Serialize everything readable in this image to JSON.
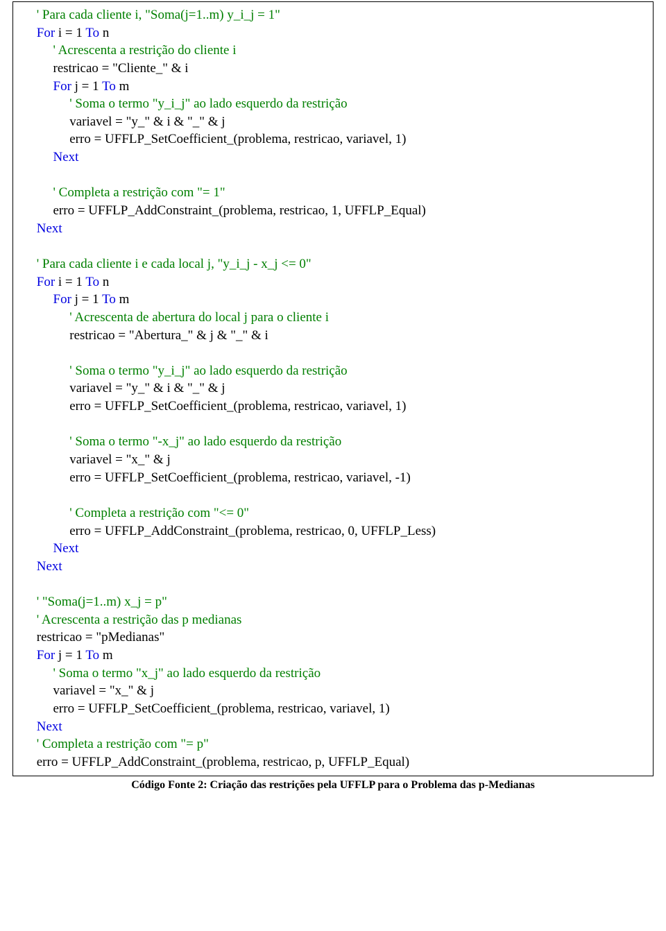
{
  "code": [
    {
      "indent": 1,
      "spans": [
        [
          "comment",
          "' Para cada cliente i, \"Soma(j=1..m) y_i_j = 1\""
        ]
      ]
    },
    {
      "indent": 1,
      "spans": [
        [
          "kw",
          "For"
        ],
        [
          "plain",
          " i = 1 "
        ],
        [
          "kw",
          "To"
        ],
        [
          "plain",
          " n"
        ]
      ]
    },
    {
      "indent": 2,
      "spans": [
        [
          "comment",
          "' Acrescenta a restrição do cliente i"
        ]
      ]
    },
    {
      "indent": 2,
      "spans": [
        [
          "plain",
          "restricao = \"Cliente_\" & i"
        ]
      ]
    },
    {
      "indent": 2,
      "spans": [
        [
          "kw",
          "For"
        ],
        [
          "plain",
          " j = 1 "
        ],
        [
          "kw",
          "To"
        ],
        [
          "plain",
          " m"
        ]
      ]
    },
    {
      "indent": 3,
      "spans": [
        [
          "comment",
          "' Soma o termo \"y_i_j\" ao lado esquerdo da restrição"
        ]
      ]
    },
    {
      "indent": 3,
      "spans": [
        [
          "plain",
          "variavel = \"y_\" & i & \"_\" & j"
        ]
      ]
    },
    {
      "indent": 3,
      "spans": [
        [
          "plain",
          "erro = UFFLP_SetCoefficient_(problema, restricao, variavel, 1)"
        ]
      ]
    },
    {
      "indent": 2,
      "spans": [
        [
          "kw",
          "Next"
        ]
      ]
    },
    {
      "blank": true
    },
    {
      "indent": 2,
      "spans": [
        [
          "comment",
          "' Completa a restrição com \"= 1\""
        ]
      ]
    },
    {
      "indent": 2,
      "spans": [
        [
          "plain",
          "erro = UFFLP_AddConstraint_(problema, restricao, 1, UFFLP_Equal)"
        ]
      ]
    },
    {
      "indent": 1,
      "spans": [
        [
          "kw",
          "Next"
        ]
      ]
    },
    {
      "blank": true
    },
    {
      "indent": 1,
      "spans": [
        [
          "comment",
          "' Para cada cliente i e cada local j, \"y_i_j - x_j <= 0\""
        ]
      ]
    },
    {
      "indent": 1,
      "spans": [
        [
          "kw",
          "For"
        ],
        [
          "plain",
          " i = 1 "
        ],
        [
          "kw",
          "To"
        ],
        [
          "plain",
          " n"
        ]
      ]
    },
    {
      "indent": 2,
      "spans": [
        [
          "kw",
          "For"
        ],
        [
          "plain",
          " j = 1 "
        ],
        [
          "kw",
          "To"
        ],
        [
          "plain",
          " m"
        ]
      ]
    },
    {
      "indent": 3,
      "spans": [
        [
          "comment",
          "' Acrescenta de abertura do local j para o cliente i"
        ]
      ]
    },
    {
      "indent": 3,
      "spans": [
        [
          "plain",
          "restricao = \"Abertura_\" & j & \"_\" & i"
        ]
      ]
    },
    {
      "blank": true
    },
    {
      "indent": 3,
      "spans": [
        [
          "comment",
          "' Soma o termo \"y_i_j\" ao lado esquerdo da restrição"
        ]
      ]
    },
    {
      "indent": 3,
      "spans": [
        [
          "plain",
          "variavel = \"y_\" & i & \"_\" & j"
        ]
      ]
    },
    {
      "indent": 3,
      "spans": [
        [
          "plain",
          "erro = UFFLP_SetCoefficient_(problema, restricao, variavel, 1)"
        ]
      ]
    },
    {
      "blank": true
    },
    {
      "indent": 3,
      "spans": [
        [
          "comment",
          "' Soma o termo \"-x_j\" ao lado esquerdo da restrição"
        ]
      ]
    },
    {
      "indent": 3,
      "spans": [
        [
          "plain",
          "variavel = \"x_\" & j"
        ]
      ]
    },
    {
      "indent": 3,
      "spans": [
        [
          "plain",
          "erro = UFFLP_SetCoefficient_(problema, restricao, variavel, -1)"
        ]
      ]
    },
    {
      "blank": true
    },
    {
      "indent": 3,
      "spans": [
        [
          "comment",
          "' Completa a restrição com \"<= 0\""
        ]
      ]
    },
    {
      "indent": 3,
      "spans": [
        [
          "plain",
          "erro = UFFLP_AddConstraint_(problema, restricao, 0, UFFLP_Less)"
        ]
      ]
    },
    {
      "indent": 2,
      "spans": [
        [
          "kw",
          "Next"
        ]
      ]
    },
    {
      "indent": 1,
      "spans": [
        [
          "kw",
          "Next"
        ]
      ]
    },
    {
      "blank": true
    },
    {
      "indent": 1,
      "spans": [
        [
          "comment",
          "' \"Soma(j=1..m) x_j = p\""
        ]
      ]
    },
    {
      "indent": 1,
      "spans": [
        [
          "comment",
          "' Acrescenta a restrição das p medianas"
        ]
      ]
    },
    {
      "indent": 1,
      "spans": [
        [
          "plain",
          "restricao = \"pMedianas\""
        ]
      ]
    },
    {
      "indent": 1,
      "spans": [
        [
          "kw",
          "For"
        ],
        [
          "plain",
          " j = 1 "
        ],
        [
          "kw",
          "To"
        ],
        [
          "plain",
          " m"
        ]
      ]
    },
    {
      "indent": 2,
      "spans": [
        [
          "comment",
          "' Soma o termo \"x_j\" ao lado esquerdo da restrição"
        ]
      ]
    },
    {
      "indent": 2,
      "spans": [
        [
          "plain",
          "variavel = \"x_\" & j"
        ]
      ]
    },
    {
      "indent": 2,
      "spans": [
        [
          "plain",
          "erro = UFFLP_SetCoefficient_(problema, restricao, variavel, 1)"
        ]
      ]
    },
    {
      "indent": 1,
      "spans": [
        [
          "kw",
          "Next"
        ]
      ]
    },
    {
      "indent": 1,
      "spans": [
        [
          "comment",
          "' Completa a restrição com \"= p\""
        ]
      ]
    },
    {
      "indent": 1,
      "spans": [
        [
          "plain",
          "erro = UFFLP_AddConstraint_(problema, restricao, p, UFFLP_Equal)"
        ]
      ]
    }
  ],
  "caption": "Código Fonte 2: Criação das restrições pela UFFLP para o Problema das p-Medianas"
}
